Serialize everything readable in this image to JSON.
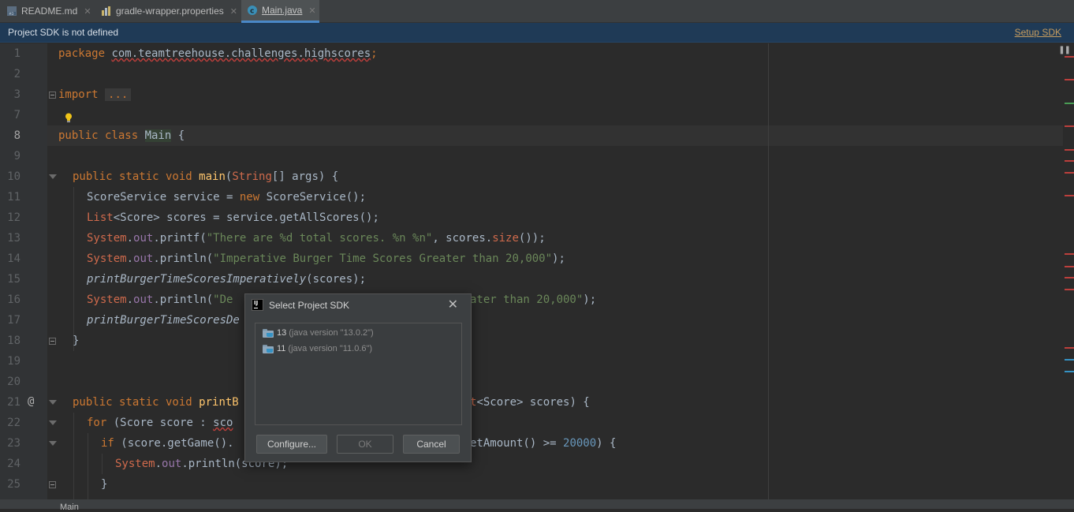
{
  "tabs": [
    {
      "label": "README.md",
      "icon": "markdown-file-icon",
      "active": false
    },
    {
      "label": "gradle-wrapper.properties",
      "icon": "properties-file-icon",
      "active": false
    },
    {
      "label": "Main.java",
      "icon": "java-class-icon",
      "active": true
    }
  ],
  "banner": {
    "message": "Project SDK is not defined",
    "action": "Setup SDK"
  },
  "gutter": {
    "line_numbers": [
      "1",
      "2",
      "3",
      "7",
      "8",
      "9",
      "10",
      "11",
      "12",
      "13",
      "14",
      "15",
      "16",
      "17",
      "18",
      "19",
      "20",
      "21",
      "22",
      "23",
      "24",
      "25"
    ],
    "current_line": "8"
  },
  "code": {
    "l1_kw": "package ",
    "l1_pkg": "com.teamtreehouse.challenges.highscores",
    "l1_semi": ";",
    "l3_kw": "import ",
    "l3_fold": "...",
    "l8_kw": "public class ",
    "l8_name": "Main",
    "l8_rest": " {",
    "l10_kw": "public static void ",
    "l10_meth": "main",
    "l10_p1": "(",
    "l10_type": "String",
    "l10_p2": "[] args) {",
    "l11_a": "ScoreService service = ",
    "l11_kw": "new",
    "l11_b": " ScoreService();",
    "l12_type": "List",
    "l12_a": "<Score> scores = service.getAllScores();",
    "l13_type": "System",
    "l13_dot": ".",
    "l13_field": "out",
    "l13_a": ".printf(",
    "l13_str": "\"There are %d total scores. %n %n\"",
    "l13_b": ", scores.",
    "l13_m": "size",
    "l13_c": "());",
    "l14_type": "System",
    "l14_dot": ".",
    "l14_field": "out",
    "l14_a": ".println(",
    "l14_str": "\"Imperative Burger Time Scores Greater than 20,000\"",
    "l14_b": ");",
    "l15_it": "printBurgerTimeScoresImperatively",
    "l15_a": "(scores);",
    "l16_type": "System",
    "l16_dot": ".",
    "l16_field": "out",
    "l16_a": ".println(",
    "l16_str1": "\"De",
    "l16_str2": "ater than 20,000\"",
    "l16_b": ");",
    "l17_it": "printBurgerTimeScoresDe",
    "l18": "}",
    "l21_kw": "public static void ",
    "l21_meth": "printB",
    "l21_type": "t",
    "l21_a": "<Score> scores) {",
    "l22_kw": "for",
    "l22_a": " (Score score : ",
    "l22_sq": "sco",
    "l23_kw": "if",
    "l23_a": " (score.getGame().",
    "l23_b": "etAmount() >= ",
    "l23_num": "20000",
    "l23_c": ") {",
    "l24_type": "System",
    "l24_dot": ".",
    "l24_field": "out",
    "l24_a": ".println(score);",
    "l25": "}"
  },
  "bottom": {
    "breadcrumb": "Main"
  },
  "dialog": {
    "title": "Select Project SDK",
    "sdks": [
      {
        "version": "13",
        "description": "(java version \"13.0.2\")"
      },
      {
        "version": "11",
        "description": "(java version \"11.0.6\")"
      }
    ],
    "configure_label": "Configure...",
    "ok_label": "OK",
    "cancel_label": "Cancel"
  },
  "colors": {
    "error_stripe": "#bc3f3c",
    "warning_stripe": "#499c54",
    "info_stripe": "#3592c4",
    "banner_bg": "#1f3a56",
    "accent": "#4a88c7"
  }
}
